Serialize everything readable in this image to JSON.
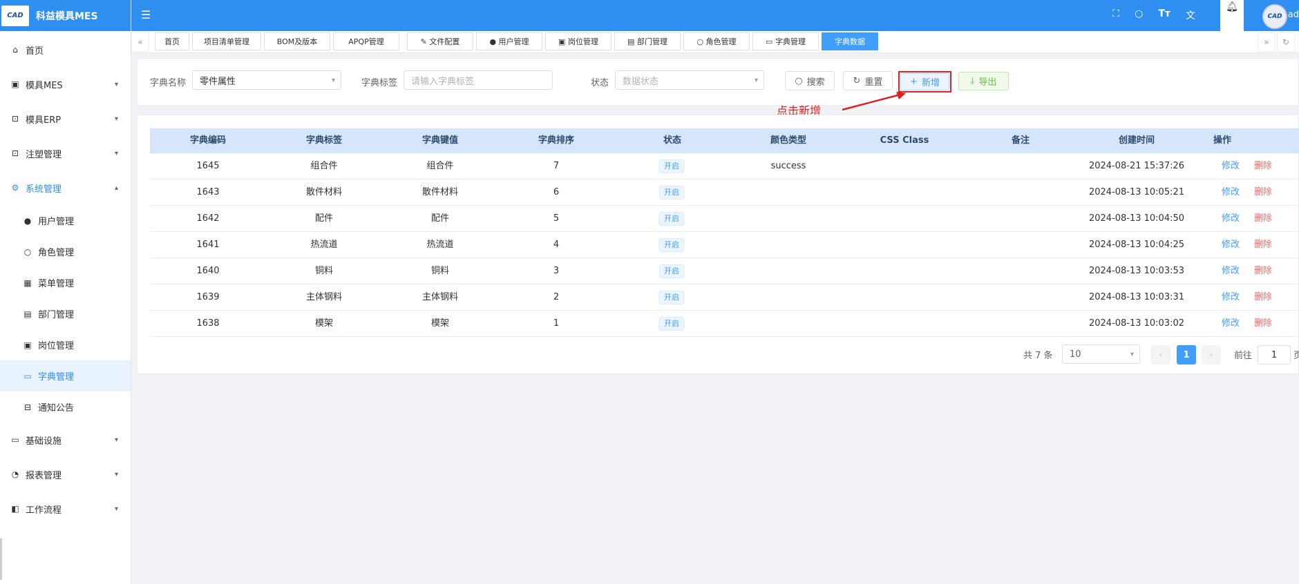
{
  "app": {
    "logo_text": "CAD",
    "title": "科益模具MES",
    "user": "ad"
  },
  "sidebar": {
    "items": [
      {
        "label": "首页",
        "icon": "home-icon"
      },
      {
        "label": "模具MES",
        "icon": "camera-icon"
      },
      {
        "label": "模具ERP",
        "icon": "box-icon"
      },
      {
        "label": "注塑管理",
        "icon": "box-icon"
      },
      {
        "label": "系统管理",
        "icon": "gear-icon"
      }
    ],
    "sub_items": [
      {
        "label": "用户管理",
        "icon": "user-icon"
      },
      {
        "label": "角色管理",
        "icon": "person-outline-icon"
      },
      {
        "label": "菜单管理",
        "icon": "grid-icon"
      },
      {
        "label": "部门管理",
        "icon": "id-card-icon"
      },
      {
        "label": "岗位管理",
        "icon": "badge-icon"
      },
      {
        "label": "字典管理",
        "icon": "book-icon"
      },
      {
        "label": "通知公告",
        "icon": "inbox-icon"
      }
    ],
    "items_bottom": [
      {
        "label": "基础设施",
        "icon": "monitor-icon"
      },
      {
        "label": "报表管理",
        "icon": "pie-icon"
      },
      {
        "label": "工作流程",
        "icon": "flow-icon"
      }
    ]
  },
  "tags": [
    "首页",
    "项目清单管理",
    "BOM及版本",
    "APQP管理",
    "文件配置",
    "用户管理",
    "岗位管理",
    "部门管理",
    "角色管理",
    "字典管理",
    "字典数据"
  ],
  "search": {
    "name_label": "字典名称",
    "name_value": "零件属性",
    "tag_label": "字典标签",
    "tag_placeholder": "请输入字典标签",
    "status_label": "状态",
    "status_placeholder": "数据状态",
    "search_btn": "搜索",
    "reset_btn": "重置",
    "add_btn": "新增",
    "export_btn": "导出"
  },
  "annotation": "点击新增",
  "table": {
    "headers": [
      "字典编码",
      "字典标签",
      "字典键值",
      "字典排序",
      "状态",
      "颜色类型",
      "CSS Class",
      "备注",
      "创建时间",
      "操作"
    ],
    "edit_label": "修改",
    "delete_label": "删除",
    "rows": [
      {
        "code": "1645",
        "label": "组合件",
        "value": "组合件",
        "sort": "7",
        "status": "开启",
        "color": "success",
        "css": "",
        "remark": "",
        "time": "2024-08-21 15:37:26"
      },
      {
        "code": "1643",
        "label": "散件材料",
        "value": "散件材料",
        "sort": "6",
        "status": "开启",
        "color": "",
        "css": "",
        "remark": "",
        "time": "2024-08-13 10:05:21"
      },
      {
        "code": "1642",
        "label": "配件",
        "value": "配件",
        "sort": "5",
        "status": "开启",
        "color": "",
        "css": "",
        "remark": "",
        "time": "2024-08-13 10:04:50"
      },
      {
        "code": "1641",
        "label": "热流道",
        "value": "热流道",
        "sort": "4",
        "status": "开启",
        "color": "",
        "css": "",
        "remark": "",
        "time": "2024-08-13 10:04:25"
      },
      {
        "code": "1640",
        "label": "铜料",
        "value": "铜料",
        "sort": "3",
        "status": "开启",
        "color": "",
        "css": "",
        "remark": "",
        "time": "2024-08-13 10:03:53"
      },
      {
        "code": "1639",
        "label": "主体钢料",
        "value": "主体钢料",
        "sort": "2",
        "status": "开启",
        "color": "",
        "css": "",
        "remark": "",
        "time": "2024-08-13 10:03:31"
      },
      {
        "code": "1638",
        "label": "模架",
        "value": "模架",
        "sort": "1",
        "status": "开启",
        "color": "",
        "css": "",
        "remark": "",
        "time": "2024-08-13 10:03:02"
      }
    ]
  },
  "pagination": {
    "total": "共 7 条",
    "page_size": "10",
    "current": "1",
    "goto_label": "前往",
    "goto_value": "1",
    "page_suffix": "页"
  }
}
